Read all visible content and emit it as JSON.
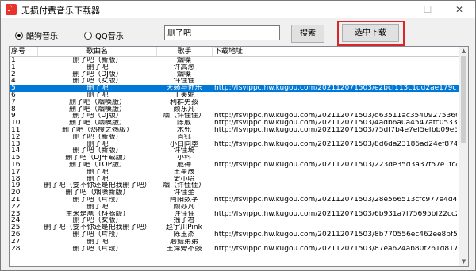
{
  "window": {
    "title": "无损付费音乐下载器",
    "min_icon": "—",
    "max_icon": "☐",
    "close_icon": "✕"
  },
  "toolbar": {
    "radio_kugou": "酷狗音乐",
    "radio_qq": "QQ音乐",
    "search_value": "删了吧",
    "search_button": "搜索",
    "download_button": "选中下载"
  },
  "table": {
    "headers": {
      "no": "序号",
      "song": "歌曲名",
      "singer": "歌手",
      "url": "下载地址"
    },
    "rows": [
      {
        "no": "1",
        "song": "删了吧（新版）",
        "singer": "烟嗓",
        "url": ""
      },
      {
        "no": "1",
        "song": "删了吧",
        "singer": "许嵩葱",
        "url": ""
      },
      {
        "no": "2",
        "song": "删了吧（DJ版）",
        "singer": "烟嗓",
        "url": ""
      },
      {
        "no": "4",
        "song": "删了吧（女版）",
        "singer": "许佳佳",
        "url": ""
      },
      {
        "no": "5",
        "song": "删了吧",
        "singer": "天籁与你乐",
        "url": "http://fsvippc.hw.kugou.com/202112071503/e2bcf113c1dd2ae179c5b1a"
      },
      {
        "no": "6",
        "song": "删了吧",
        "singer": "丁美妮",
        "url": ""
      },
      {
        "no": "7",
        "song": "删了吧（烟嗓版）",
        "singer": "利群男孩",
        "url": ""
      },
      {
        "no": "8",
        "song": "删了吧（烟嗓版）",
        "singer": "颜东凡",
        "url": ""
      },
      {
        "no": "9",
        "song": "删了吧（DJ版）",
        "singer": "烟（许佳佳）",
        "url": "http://fsvippc.hw.kugou.com/202112071503/d63511ac354092753608d498"
      },
      {
        "no": "10",
        "song": "删了吧（烟嗓版）",
        "singer": "陈戚",
        "url": "http://fsvippc.hw.kugou.com/202112071503/4adb6a0a4547afc05333cc39"
      },
      {
        "no": "11",
        "song": "删了吧（热搜之殇版）",
        "singer": "木兜",
        "url": "http://fsvippc.hw.kugou.com/202112071503/75df7b4e7ef5efbb09e5a7aa84ed"
      },
      {
        "no": "12",
        "song": "删了吧（新版）",
        "singer": "肖钰",
        "url": ""
      },
      {
        "no": "13",
        "song": "删了吧",
        "singer": "小白同墨",
        "url": "http://fsvippc.hw.kugou.com/202112071503/8d6da23186ad24ef8748f6965"
      },
      {
        "no": "14",
        "song": "删了吧（新版）",
        "singer": "许佳琦",
        "url": ""
      },
      {
        "no": "15",
        "song": "删了吧（DJ车载版）",
        "singer": "小科",
        "url": ""
      },
      {
        "no": "16",
        "song": "删了吧（TOP版）",
        "singer": "戚神",
        "url": "http://fsvippc.hw.kugou.com/202112071503/223de35d3a37f57e1fc4dd98a"
      },
      {
        "no": "17",
        "song": "删了吧",
        "singer": "王星辰",
        "url": ""
      },
      {
        "no": "18",
        "song": "删了吧",
        "singer": "史小哈",
        "url": ""
      },
      {
        "no": "19",
        "song": "删了吧（要不你还是把我删了吧）",
        "singer": "烟（许佳佳）",
        "url": ""
      },
      {
        "no": "20",
        "song": "删了吧（烟嗓新版）",
        "singer": "许佳奎",
        "url": ""
      },
      {
        "no": "21",
        "song": "删了吧（片段）",
        "singer": "阿阳数字",
        "url": "http://fsvippc.hw.kugou.com/202112071503/28e566513cfc977e4d4e3f4187"
      },
      {
        "no": "22",
        "song": "删了吧",
        "singer": "颜亦凡",
        "url": ""
      },
      {
        "no": "23",
        "song": "生来是凰（抖腾版）",
        "singer": "许佳佳",
        "url": "http://fsvippc.hw.kugou.com/202112071503/6b931a7f75695bf22cc22f226"
      },
      {
        "no": "24",
        "song": "删了吧（女版）",
        "singer": "摇子君",
        "url": ""
      },
      {
        "no": "25",
        "song": "删了吧（要不你还是把我删了吧）",
        "singer": "赵宇川Pink",
        "url": ""
      },
      {
        "no": "26",
        "song": "删了吧（片段）",
        "singer": "陈玉杰",
        "url": "http://fsvippc.hw.kugou.com/202112071503/8b770556ec462ee8bf5a4a9f44"
      },
      {
        "no": "27",
        "song": "删了吧",
        "singer": "蘑菇弟弟",
        "url": ""
      },
      {
        "no": "28",
        "song": "删了吧（片段）",
        "singer": "王泽旁不鼓",
        "url": "http://fsvippc.hw.kugou.com/202112071503/87ea624ab80f261d8177a44a48"
      }
    ]
  }
}
